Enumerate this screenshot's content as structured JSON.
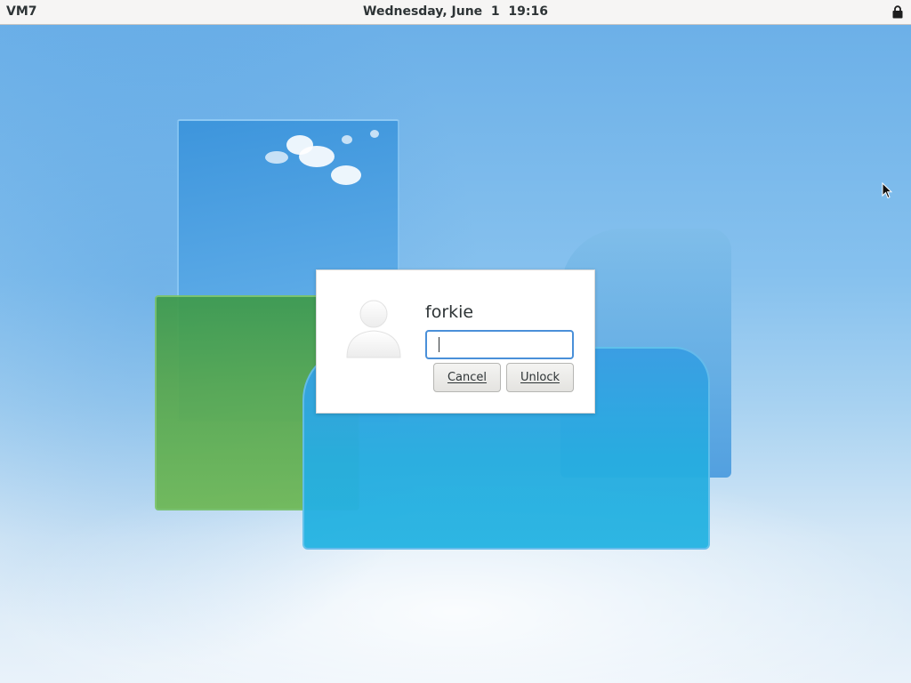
{
  "topbar": {
    "host": "VM7",
    "clock": "Wednesday, June  1  19:16",
    "lock_icon": "lock-icon"
  },
  "dialog": {
    "avatar_icon": "user-avatar-icon",
    "username": "forkie",
    "password_value": "",
    "cancel_label": "Cancel",
    "unlock_label": "Unlock"
  },
  "colors": {
    "topbar_bg": "#f6f5f4",
    "dialog_bg": "#ffffff",
    "focus_ring": "#4a90d9",
    "text": "#2e3436"
  }
}
